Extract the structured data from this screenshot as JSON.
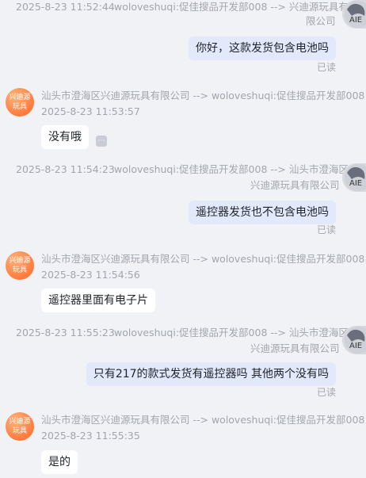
{
  "shop": {
    "avatar_line1": "兴迪源",
    "avatar_line2": "玩具"
  },
  "messages": [
    {
      "time": "2025-8-23 11:52:44",
      "route_line1": "woloveshuqi:促佳搜品开发部008 --> 兴迪源玩具有",
      "route_line2": "限公司",
      "text": "你好，这款发货包含电池吗",
      "status": "已读"
    },
    {
      "route": "汕头市澄海区兴迪源玩具有限公司 --> woloveshuqi:促佳搜品开发部008",
      "time": "2025-8-23 11:53:57",
      "text": "没有哦"
    },
    {
      "time": "2025-8-23 11:54:23",
      "route_line1": "woloveshuqi:促佳搜品开发部008 --> 汕头市澄海区",
      "route_line2": "兴迪源玩具有限公司",
      "text": "遥控器发货也不包含电池吗",
      "status": "已读"
    },
    {
      "route": "汕头市澄海区兴迪源玩具有限公司 --> woloveshuqi:促佳搜品开发部008",
      "time": "2025-8-23 11:54:56",
      "text": "遥控器里面有电子片"
    },
    {
      "time": "2025-8-23 11:55:23",
      "route_line1": "woloveshuqi:促佳搜品开发部008 --> 汕头市澄海区",
      "route_line2": "兴迪源玩具有限公司",
      "text": "只有217的款式发货有遥控器吗 其他两个没有吗",
      "status": "已读"
    },
    {
      "route": "汕头市澄海区兴迪源玩具有限公司 --> woloveshuqi:促佳搜品开发部008",
      "time": "2025-8-23 11:55:35",
      "text": "是的"
    }
  ]
}
